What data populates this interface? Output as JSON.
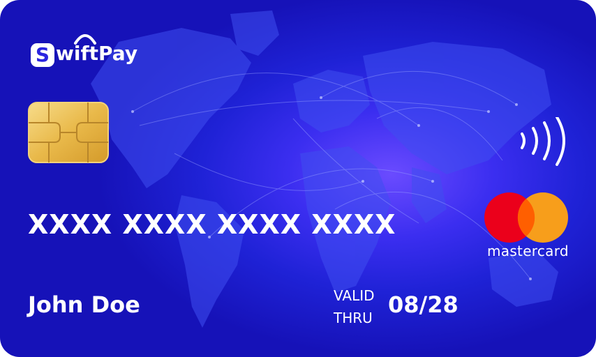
{
  "brand": {
    "badge_letter": "S",
    "name_rest": "wiftPay"
  },
  "card": {
    "number": "XXXX XXXX XXXX XXXX",
    "holder_name": "John Doe",
    "valid_label_line1": "VALID",
    "valid_label_line2": "THRU",
    "expiry": "08/28"
  },
  "network": {
    "name": "mastercard",
    "colors": {
      "red": "#EB001B",
      "orange": "#F79E1B",
      "overlap": "#FF5F00"
    }
  },
  "icons": [
    "chip-icon",
    "contactless-icon",
    "mastercard-logo",
    "world-map"
  ],
  "colors": {
    "card_background": "#1f22d6",
    "card_glow": "#6a4bff",
    "chip_gold": "#e9b94a",
    "text": "#ffffff"
  }
}
